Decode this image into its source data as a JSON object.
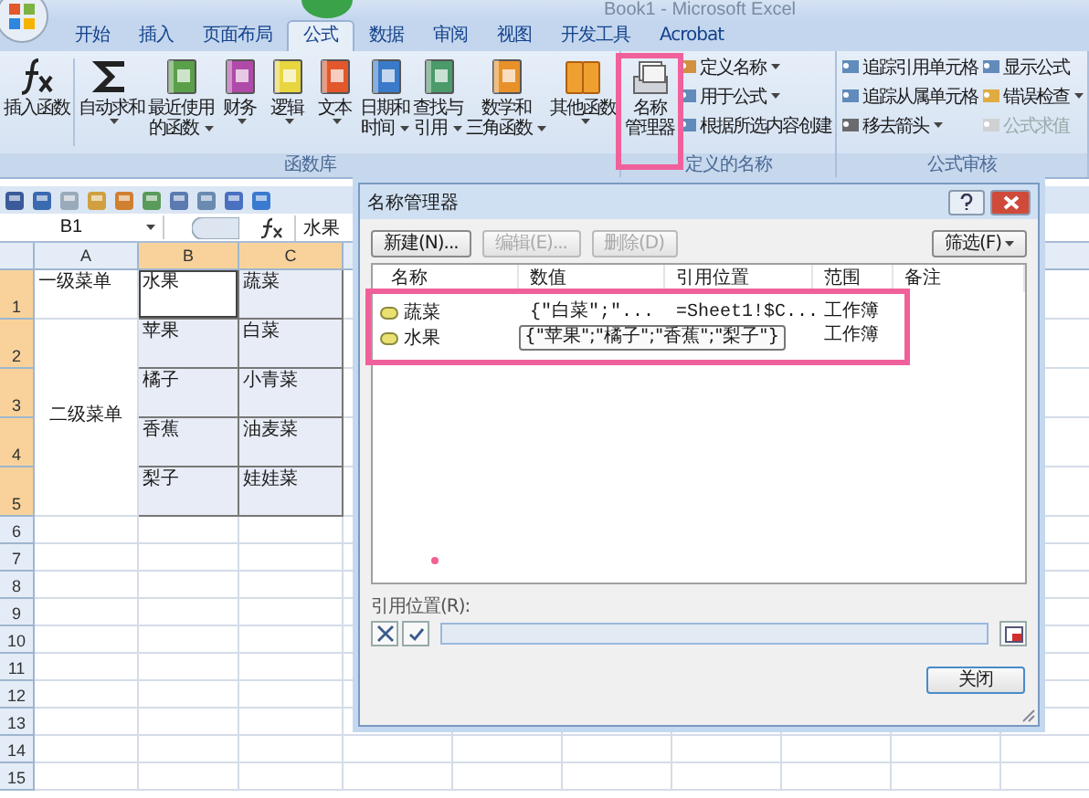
{
  "window": {
    "title": "Book1 - Microsoft Excel"
  },
  "ribbon": {
    "tabs": [
      {
        "label": "开始",
        "selected": false
      },
      {
        "label": "插入",
        "selected": false
      },
      {
        "label": "页面布局",
        "selected": false
      },
      {
        "label": "公式",
        "selected": true
      },
      {
        "label": "数据",
        "selected": false
      },
      {
        "label": "审阅",
        "selected": false
      },
      {
        "label": "视图",
        "selected": false
      },
      {
        "label": "开发工具",
        "selected": false
      },
      {
        "label": "Acrobat",
        "selected": false
      }
    ],
    "groups": [
      {
        "label": "函数库",
        "items": [
          {
            "kind": "large",
            "lines": [
              "插入函数"
            ],
            "dropdown": false
          },
          {
            "kind": "separator"
          },
          {
            "kind": "large",
            "lines": [
              "自动求和"
            ],
            "dropdown": true
          },
          {
            "kind": "large",
            "lines": [
              "最近使用",
              "的函数"
            ],
            "dropdown": true
          },
          {
            "kind": "large",
            "lines": [
              "财务"
            ],
            "dropdown": true
          },
          {
            "kind": "large",
            "lines": [
              "逻辑"
            ],
            "dropdown": true
          },
          {
            "kind": "large",
            "lines": [
              "文本"
            ],
            "dropdown": true
          },
          {
            "kind": "large",
            "lines": [
              "日期和",
              "时间"
            ],
            "dropdown": true
          },
          {
            "kind": "large",
            "lines": [
              "查找与",
              "引用"
            ],
            "dropdown": true
          },
          {
            "kind": "large",
            "lines": [
              "数学和",
              "三角函数"
            ],
            "dropdown": true
          },
          {
            "kind": "large",
            "lines": [
              "其他函数"
            ],
            "dropdown": true
          }
        ]
      },
      {
        "label": "定义的名称",
        "items": [
          {
            "kind": "large",
            "lines": [
              "名称",
              "管理器"
            ],
            "dropdown": false
          },
          {
            "kind": "small",
            "label": "定义名称",
            "dropdown": true
          },
          {
            "kind": "small",
            "label": "用于公式",
            "dropdown": true
          },
          {
            "kind": "small",
            "label": "根据所选内容创建",
            "dropdown": false
          }
        ]
      },
      {
        "label": "公式审核",
        "items": [
          {
            "kind": "small",
            "label": "追踪引用单元格",
            "dropdown": false,
            "disabled": false
          },
          {
            "kind": "small",
            "label": "追踪从属单元格",
            "dropdown": false,
            "disabled": false
          },
          {
            "kind": "small",
            "label": "移去箭头",
            "dropdown": true,
            "disabled": false
          },
          {
            "kind": "small",
            "label": "显示公式",
            "dropdown": false,
            "disabled": false
          },
          {
            "kind": "small",
            "label": "错误检查",
            "dropdown": true,
            "disabled": false
          },
          {
            "kind": "small",
            "label": "公式求值",
            "dropdown": false,
            "disabled": true
          }
        ]
      }
    ]
  },
  "formula_bar": {
    "name_box": "B1",
    "value": "水果"
  },
  "sheet": {
    "columns": [
      {
        "label": "A",
        "selected": false
      },
      {
        "label": "B",
        "selected": true
      },
      {
        "label": "C",
        "selected": true
      }
    ],
    "rows": [
      {
        "number": "1",
        "selected": true,
        "cells": [
          {
            "kind": "cell",
            "text": "一级菜单",
            "selected": false,
            "active": false
          },
          {
            "kind": "cell",
            "text": "水果",
            "selected": true,
            "active": true
          },
          {
            "kind": "cell",
            "text": "蔬菜",
            "selected": true,
            "active": false
          }
        ]
      },
      {
        "number": "2",
        "selected": true,
        "cells": [
          {
            "kind": "merge_cont"
          },
          {
            "kind": "cell",
            "text": "苹果",
            "selected": true,
            "active": false
          },
          {
            "kind": "cell",
            "text": "白菜",
            "selected": true,
            "active": false
          }
        ]
      },
      {
        "number": "3",
        "selected": true,
        "cells": [
          {
            "kind": "merge_top",
            "text": "二级菜单",
            "selected": false,
            "active": false
          },
          {
            "kind": "cell",
            "text": "橘子",
            "selected": true,
            "active": false
          },
          {
            "kind": "cell",
            "text": "小青菜",
            "selected": true,
            "active": false
          }
        ]
      },
      {
        "number": "4",
        "selected": true,
        "cells": [
          {
            "kind": "merge_cont"
          },
          {
            "kind": "cell",
            "text": "香蕉",
            "selected": true,
            "active": false
          },
          {
            "kind": "cell",
            "text": "油麦菜",
            "selected": true,
            "active": false
          }
        ]
      },
      {
        "number": "5",
        "selected": true,
        "cells": [
          {
            "kind": "merge_cont"
          },
          {
            "kind": "cell",
            "text": "梨子",
            "selected": true,
            "active": false
          },
          {
            "kind": "cell",
            "text": "娃娃菜",
            "selected": true,
            "active": false
          }
        ]
      },
      {
        "number": "6",
        "selected": false,
        "cells": []
      },
      {
        "number": "7",
        "selected": false,
        "cells": []
      },
      {
        "number": "8",
        "selected": false,
        "cells": []
      },
      {
        "number": "9",
        "selected": false,
        "cells": []
      },
      {
        "number": "10",
        "selected": false,
        "cells": []
      },
      {
        "number": "11",
        "selected": false,
        "cells": []
      },
      {
        "number": "12",
        "selected": false,
        "cells": []
      },
      {
        "number": "13",
        "selected": false,
        "cells": []
      },
      {
        "number": "14",
        "selected": false,
        "cells": []
      },
      {
        "number": "15",
        "selected": false,
        "cells": []
      }
    ]
  },
  "dialog": {
    "title": "名称管理器",
    "buttons": [
      {
        "label": "新建(N)...",
        "disabled": false
      },
      {
        "label": "编辑(E)...",
        "disabled": true
      },
      {
        "label": "删除(D)",
        "disabled": true
      }
    ],
    "filter": "筛选(F)",
    "columns": [
      "名称",
      "数值",
      "引用位置",
      "范围",
      "备注"
    ],
    "rows": [
      {
        "name": "蔬菜",
        "value": "{\"白菜\";\"...",
        "refers_to": "=Sheet1!$C...",
        "scope": "工作簿",
        "popup": false
      },
      {
        "name": "水果",
        "value": "{\"苹果\";\"橘子\";\"香蕉\";\"梨子\"}",
        "scope": "工作簿",
        "popup": true
      }
    ],
    "refers_label": "引用位置(R):",
    "close": "关闭"
  }
}
